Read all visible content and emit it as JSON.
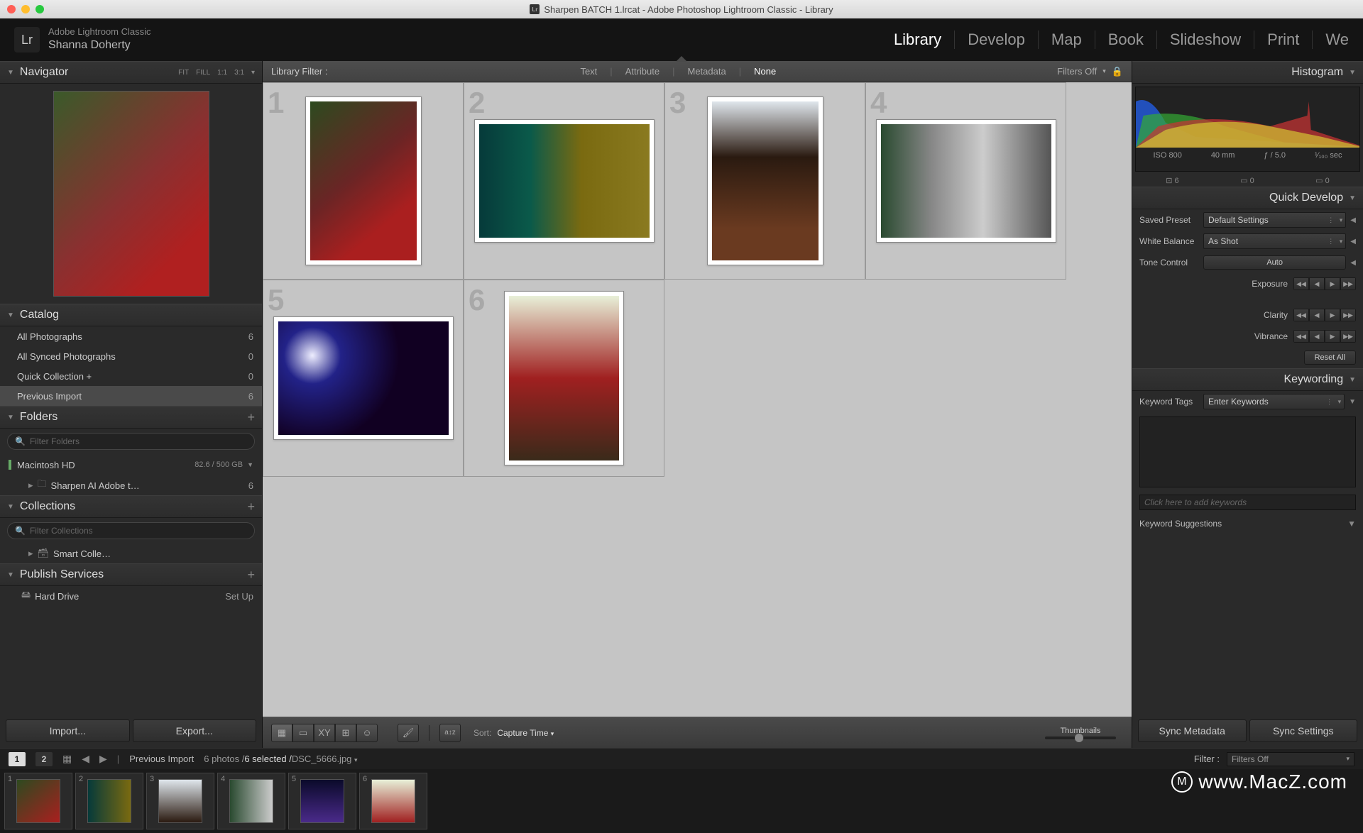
{
  "window_title": "Sharpen BATCH 1.lrcat - Adobe Photoshop Lightroom Classic - Library",
  "app": {
    "name": "Adobe Lightroom Classic",
    "user": "Shanna Doherty",
    "logo": "Lr"
  },
  "modules": [
    "Library",
    "Develop",
    "Map",
    "Book",
    "Slideshow",
    "Print",
    "We"
  ],
  "active_module": "Library",
  "navigator": {
    "title": "Navigator",
    "opts": [
      "FIT",
      "FILL",
      "1:1",
      "3:1"
    ]
  },
  "catalog": {
    "title": "Catalog",
    "items": [
      {
        "label": "All Photographs",
        "count": 6
      },
      {
        "label": "All Synced Photographs",
        "count": 0
      },
      {
        "label": "Quick Collection  +",
        "count": 0
      },
      {
        "label": "Previous Import",
        "count": 6,
        "selected": true
      }
    ]
  },
  "folders": {
    "title": "Folders",
    "filter_placeholder": "Filter Folders",
    "drive": "Macintosh HD",
    "drive_size": "82.6 / 500 GB",
    "items": [
      {
        "label": "Sharpen AI Adobe t…",
        "count": 6
      }
    ]
  },
  "collections": {
    "title": "Collections",
    "filter_placeholder": "Filter Collections",
    "items": [
      {
        "label": "Smart Colle…"
      }
    ]
  },
  "publish": {
    "title": "Publish Services",
    "items": [
      {
        "label": "Hard Drive",
        "action": "Set Up"
      }
    ]
  },
  "buttons": {
    "import": "Import...",
    "export": "Export..."
  },
  "filterbar": {
    "label": "Library Filter :",
    "tabs": [
      "Text",
      "Attribute",
      "Metadata",
      "None"
    ],
    "active": "None",
    "state": "Filters Off"
  },
  "grid": {
    "count": 6
  },
  "gridbar": {
    "sort_label": "Sort:",
    "sort_value": "Capture Time",
    "thumb_label": "Thumbnails"
  },
  "histogram": {
    "title": "Histogram",
    "iso": "ISO 800",
    "focal": "40 mm",
    "aperture": "ƒ / 5.0",
    "shutter": "¹⁄₁₀₀ sec",
    "crop": "6",
    "badge1": "0",
    "badge2": "0"
  },
  "quick_develop": {
    "title": "Quick Develop",
    "saved_preset": {
      "label": "Saved Preset",
      "value": "Default Settings"
    },
    "white_balance": {
      "label": "White Balance",
      "value": "As Shot"
    },
    "tone_control": {
      "label": "Tone Control",
      "auto": "Auto"
    },
    "exposure": "Exposure",
    "clarity": "Clarity",
    "vibrance": "Vibrance",
    "reset": "Reset All"
  },
  "keywording": {
    "title": "Keywording",
    "tags_label": "Keyword Tags",
    "tags_value": "Enter Keywords",
    "placeholder": "Click here to add keywords",
    "suggestions": "Keyword Suggestions"
  },
  "sync": {
    "metadata": "Sync Metadata",
    "settings": "Sync Settings"
  },
  "status": {
    "screens": [
      "1",
      "2"
    ],
    "context": "Previous Import",
    "summary": "6 photos /",
    "selected": "6 selected /",
    "file": "DSC_5666.jpg",
    "filter_label": "Filter :",
    "filter_value": "Filters Off"
  },
  "watermark": "www.MacZ.com"
}
